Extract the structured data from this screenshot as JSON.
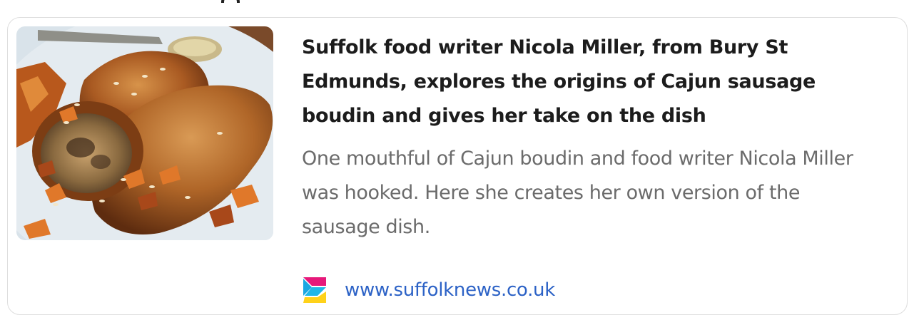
{
  "preview": {
    "headline": "Suffolk food writer Nicola Miller, from Bury St Edmunds, explores the origins of Cajun sausage boudin and gives her take on the dish",
    "summary": "One mouthful of Cajun boudin and food writer Nicola Miller was hooked. Here she creates her own version of the sausage dish.",
    "source_url": "www.suffolknews.co.uk",
    "source_icon": "suffolk-news-logo-icon",
    "image_icon": "sausage-roll-photo"
  },
  "colors": {
    "headline": "#1c1c1c",
    "summary": "#6b6b6b",
    "link": "#2c62c6",
    "card_border": "#dedede"
  }
}
